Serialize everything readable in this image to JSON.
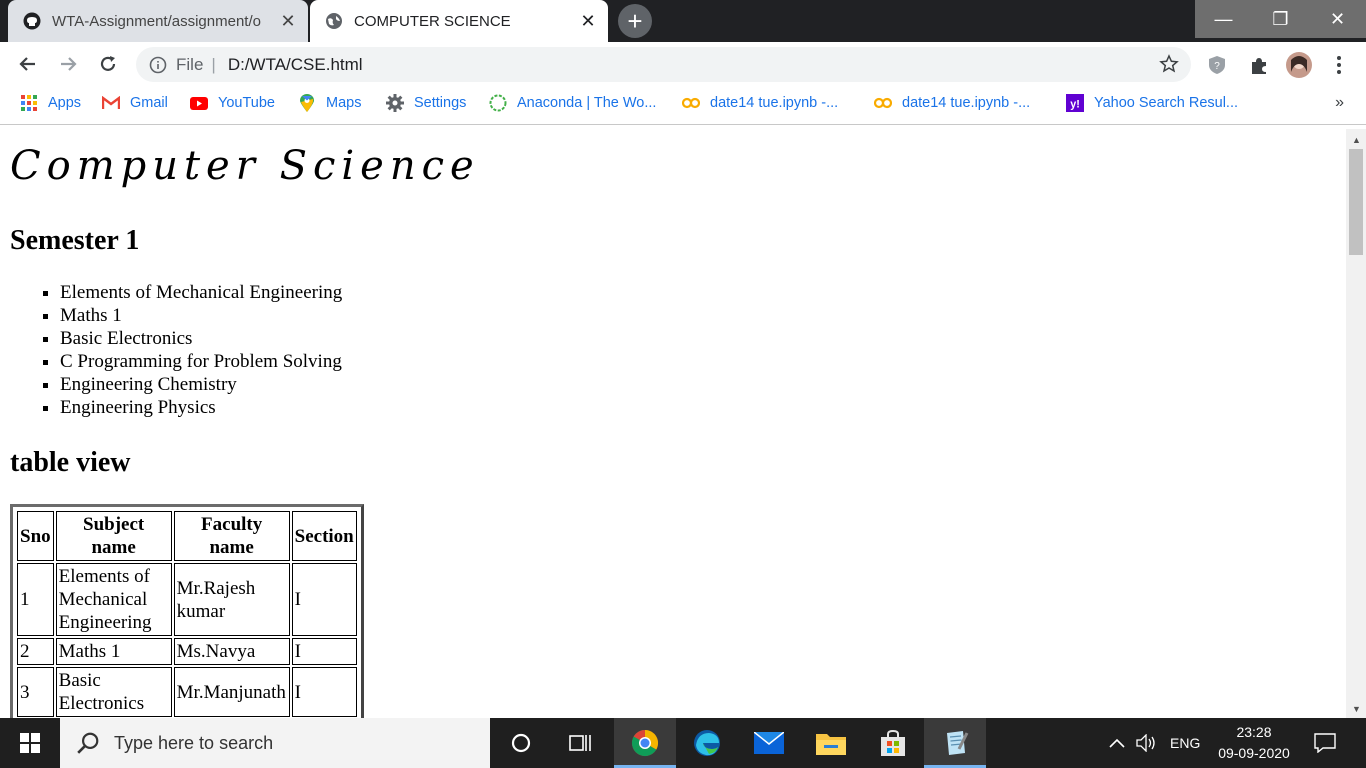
{
  "tabs": [
    {
      "label": "WTA-Assignment/assignment/o",
      "active": false
    },
    {
      "label": "COMPUTER SCIENCE",
      "active": true
    }
  ],
  "address": {
    "scheme_label": "File",
    "url": "D:/WTA/CSE.html"
  },
  "bookmarks": [
    {
      "label": "Apps",
      "icon": "apps-grid-icon"
    },
    {
      "label": "Gmail",
      "icon": "gmail-icon"
    },
    {
      "label": "YouTube",
      "icon": "youtube-icon"
    },
    {
      "label": "Maps",
      "icon": "maps-icon"
    },
    {
      "label": "Settings",
      "icon": "gear-icon"
    },
    {
      "label": "Anaconda | The Wo...",
      "icon": "anaconda-icon"
    },
    {
      "label": "date14 tue.ipynb -...",
      "icon": "colab-icon"
    },
    {
      "label": "date14 tue.ipynb -...",
      "icon": "colab-icon"
    },
    {
      "label": "Yahoo Search Resul...",
      "icon": "yahoo-icon"
    }
  ],
  "bookmarks_more": "»",
  "page": {
    "title": "Computer Science",
    "semester_heading": "Semester 1",
    "subjects": [
      "Elements of Mechanical Engineering",
      "Maths 1",
      "Basic Electronics",
      "C Programming for Problem Solving",
      "Engineering Chemistry",
      "Engineering Physics"
    ],
    "table_heading": "table view",
    "table": {
      "headers": [
        "Sno",
        "Subject name",
        "Faculty name",
        "Section"
      ],
      "rows": [
        [
          "1",
          "Elements of Mechanical Engineering",
          "Mr.Rajesh kumar",
          "I"
        ],
        [
          "2",
          "Maths 1",
          "Ms.Navya",
          "I"
        ],
        [
          "3",
          "Basic Electronics",
          "Mr.Manjunath",
          "I"
        ]
      ]
    }
  },
  "taskbar": {
    "search_placeholder": "Type here to search",
    "language": "ENG",
    "time": "23:28",
    "date": "09-09-2020"
  },
  "colors": {
    "titlebar": "#202124",
    "taskbar": "#1f1f1f",
    "link_text": "#1a73e8"
  }
}
